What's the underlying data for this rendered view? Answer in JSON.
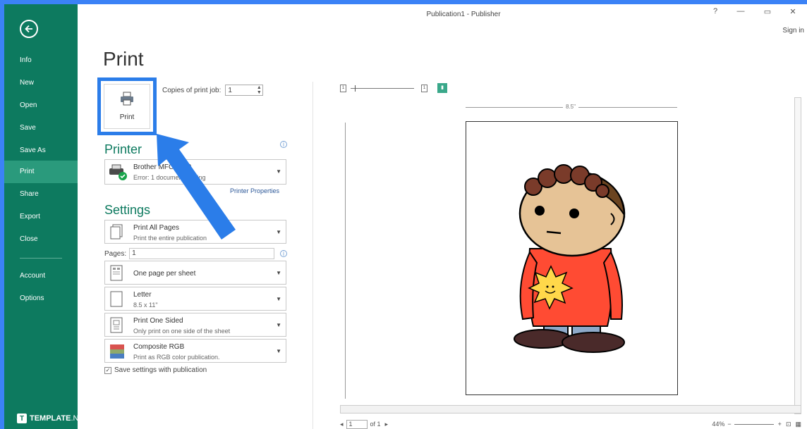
{
  "window": {
    "title": "Publication1 - Publisher",
    "help": "?",
    "minimize": "—",
    "restore": "▭",
    "close": "✕",
    "sign_in": "Sign in"
  },
  "sidebar": {
    "back_icon": "arrow-left-icon",
    "items": [
      {
        "label": "Info"
      },
      {
        "label": "New"
      },
      {
        "label": "Open"
      },
      {
        "label": "Save"
      },
      {
        "label": "Save As"
      },
      {
        "label": "Print",
        "active": true
      },
      {
        "label": "Share"
      },
      {
        "label": "Export"
      },
      {
        "label": "Close"
      },
      {
        "label": "Account"
      },
      {
        "label": "Options"
      }
    ],
    "brand_logo": "T",
    "brand_bold": "TEMPLATE",
    "brand_rest": ".NET",
    "colors": {
      "bg": "#0d7a5f",
      "active": "#2a9a7c"
    }
  },
  "main": {
    "title": "Print",
    "print_button": "Print",
    "copies_label": "Copies of print job:",
    "copies_value": "1",
    "printer_heading": "Printer",
    "printer_name": "Brother MFC-J200",
    "printer_status": "Error: 1 document waiting",
    "printer_properties": "Printer Properties",
    "settings_heading": "Settings",
    "pages_label": "Pages:",
    "pages_value": "1",
    "settings": [
      {
        "title": "Print All Pages",
        "subtitle": "Print the entire publication"
      },
      {
        "title": "One page per sheet",
        "subtitle": ""
      },
      {
        "title": "Letter",
        "subtitle": "8.5 x 11\""
      },
      {
        "title": "Print One Sided",
        "subtitle": "Only print on one side of the sheet"
      },
      {
        "title": "Composite RGB",
        "subtitle": "Print as RGB color publication."
      }
    ],
    "save_settings": "Save settings with publication",
    "highlight_color": "#2b7de9"
  },
  "preview": {
    "ruler_width_label": "8.5\"",
    "page_number": "1",
    "page_of": "of 1",
    "zoom": "44%"
  }
}
